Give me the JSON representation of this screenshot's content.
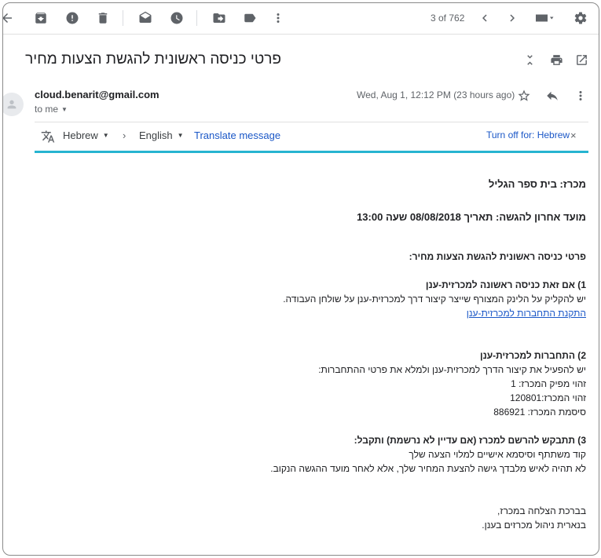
{
  "toolbar": {
    "icons": [
      "back-arrow-icon",
      "archive-icon",
      "report-spam-icon",
      "delete-icon",
      "mark-unread-icon",
      "snooze-icon",
      "move-to-icon",
      "label-icon",
      "more-icon"
    ],
    "pager": "3 of 762"
  },
  "email": {
    "subject": "פרטי כניסה ראשונית להגשת הצעות מחיר",
    "sender": "cloud.benarit@gmail.com",
    "to": "to me",
    "date": "Wed, Aug 1, 12:12 PM (23 hours ago)"
  },
  "translate": {
    "from_lang": "Hebrew",
    "to_lang": "English",
    "translate_link": "Translate message",
    "turn_off": "Turn off for: Hebrew",
    "close": "×"
  },
  "body": {
    "l1": "מכרז: בית ספר הגליל",
    "l2": "מועד אחרון להגשה: תאריך 08/08/2018 שעה 13:00",
    "l3": "פרטי כניסה ראשונית להגשת הצעות מחיר:",
    "l4": "1) אם זאת כניסה ראשונה למכרזית-ענן",
    "l5": "יש להקליק על הלינק המצורף שייצר קיצור דרך למכרזית-ענן על שולחן העבודה.",
    "l6": "התקנת התחברות למכרזית-ענן",
    "l7": "2) התחברות למכרזית-ענן",
    "l8": "יש להפעיל את קיצור הדרך למכרזית-ענן ולמלא את פרטי ההתחברות:",
    "l9": "זהוי מפיק המכרז: 1",
    "l10": "זהוי המכרז:120801",
    "l11": "סיסמת המכרז: 886921",
    "l12": "3) תתבקש להרשם למכרז (אם עדיין לא נרשמת) ותקבל:",
    "l13": "קוד משתתף וסיסמא אישיים למלוי הצעה שלך",
    "l14": "לא תהיה לאיש מלבדך גישה להצעת המחיר שלך, אלא לאחר מועד ההגשה הנקוב.",
    "l15": "בברכת הצלחה במכרז,",
    "l16": "בנארית ניהול מכרזים בענן."
  }
}
